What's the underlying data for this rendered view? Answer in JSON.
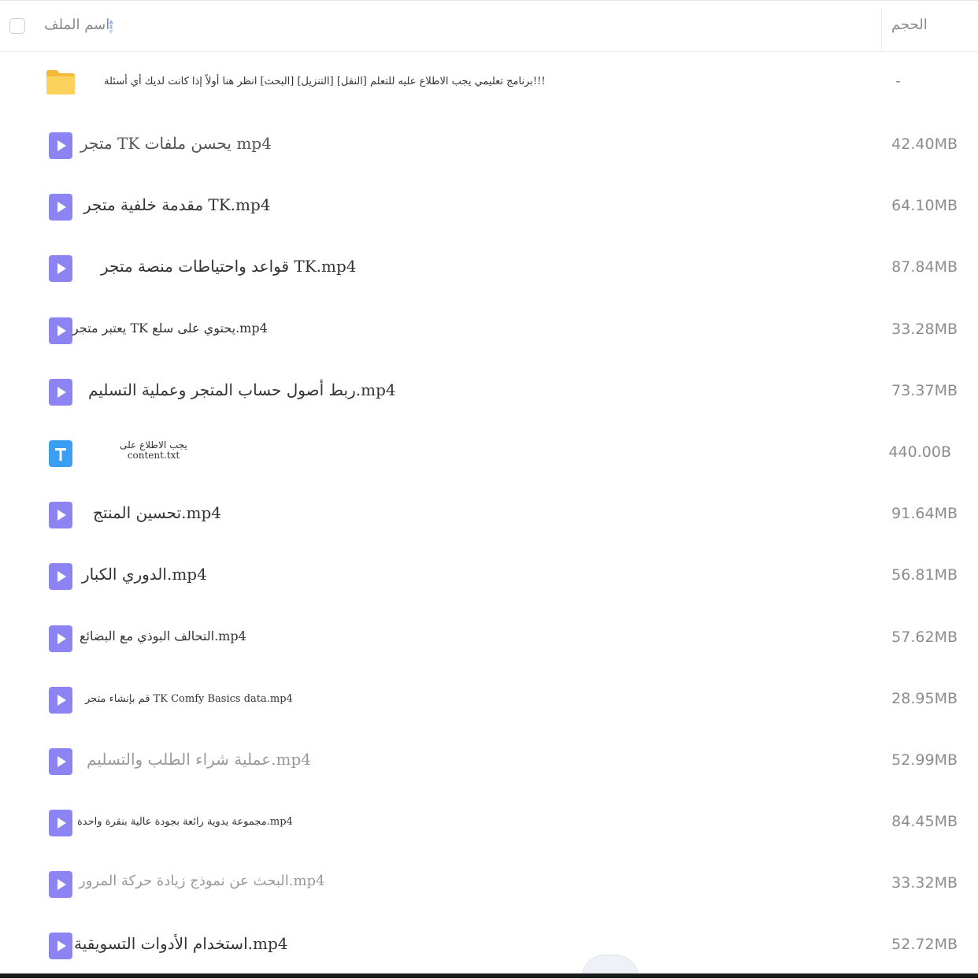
{
  "header": {
    "name_label": "اسم الملف",
    "size_label": "الحجم"
  },
  "files": [
    {
      "icon": "folder-icon",
      "name": "برنامج تعليمي يجب الاطلاع عليه للتعلم [النقل] [التنزيل] [البحث] انظر هنا أولاً إذا كانت لديك أي أسئلة!!!",
      "size": "-"
    },
    {
      "icon": "video-file-icon",
      "name": "متجر TK يحسن ملفات mp4",
      "size": "42.40MB"
    },
    {
      "icon": "video-file-icon",
      "name": "مقدمة خلفية متجر TK.mp4",
      "size": "64.10MB"
    },
    {
      "icon": "video-file-icon",
      "name": "قواعد واحتياطات منصة متجر TK.mp4",
      "size": "87.84MB"
    },
    {
      "icon": "video-file-icon",
      "name": "يعتبر متجر TK يحتوي على سلع.mp4",
      "size": "33.28MB"
    },
    {
      "icon": "video-file-icon",
      "name": "ربط أصول حساب المتجر وعملية التسليم.mp4",
      "size": "73.37MB"
    },
    {
      "icon": "text-file-icon",
      "name": "يجب الاطلاع على content.txt",
      "size": "440.00B"
    },
    {
      "icon": "video-file-icon",
      "name": "تحسين المنتج.mp4",
      "size": "91.64MB"
    },
    {
      "icon": "video-file-icon",
      "name": "الدوري الكبار.mp4",
      "size": "56.81MB"
    },
    {
      "icon": "video-file-icon",
      "name": "التحالف البوذي مع البضائع.mp4",
      "size": "57.62MB"
    },
    {
      "icon": "video-file-icon",
      "name": "قم بإنشاء متجر TK Comfy Basics data.mp4",
      "size": "28.95MB"
    },
    {
      "icon": "video-file-icon",
      "name": "عملية شراء الطلب والتسليم.mp4",
      "size": "52.99MB"
    },
    {
      "icon": "video-file-icon",
      "name": "مجموعة يدوية رائعة بجودة عالية بنقرة واحدة.mp4",
      "size": "84.45MB"
    },
    {
      "icon": "video-file-icon",
      "name": "البحث عن نموذج زيادة حركة المرور.mp4",
      "size": "33.32MB"
    },
    {
      "icon": "video-file-icon",
      "name": "استخدام الأدوات التسويقية.mp4",
      "size": "52.72MB"
    }
  ],
  "colors": {
    "folder": "#f7c948",
    "video": "#8c84f2",
    "text_file": "#3a9ef5"
  }
}
